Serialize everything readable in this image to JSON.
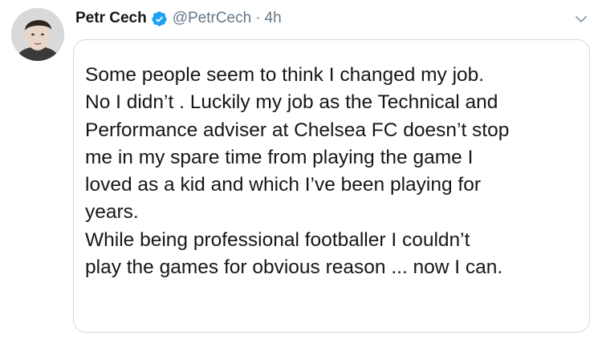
{
  "tweet": {
    "author": {
      "display_name": "Petr Cech",
      "handle": "@PetrCech",
      "verified": true,
      "avatar_icon": "profile-photo"
    },
    "separator": "·",
    "timestamp": "4h",
    "menu_icon": "chevron-down-icon",
    "image_text": [
      "Some people seem to think I changed my job.",
      "No I didn’t . Luckily my job as the Technical and",
      "Performance adviser at Chelsea FC doesn’t stop",
      "me in my spare time from playing the game I",
      "loved as a kid and which I’ve been playing for",
      "years.",
      "While being professional footballer I couldn’t",
      "play the games for obvious reason ... now I can."
    ]
  },
  "colors": {
    "name": "#14171a",
    "secondary": "#657786",
    "verified": "#1da1f2",
    "border": "#cfd9de"
  }
}
